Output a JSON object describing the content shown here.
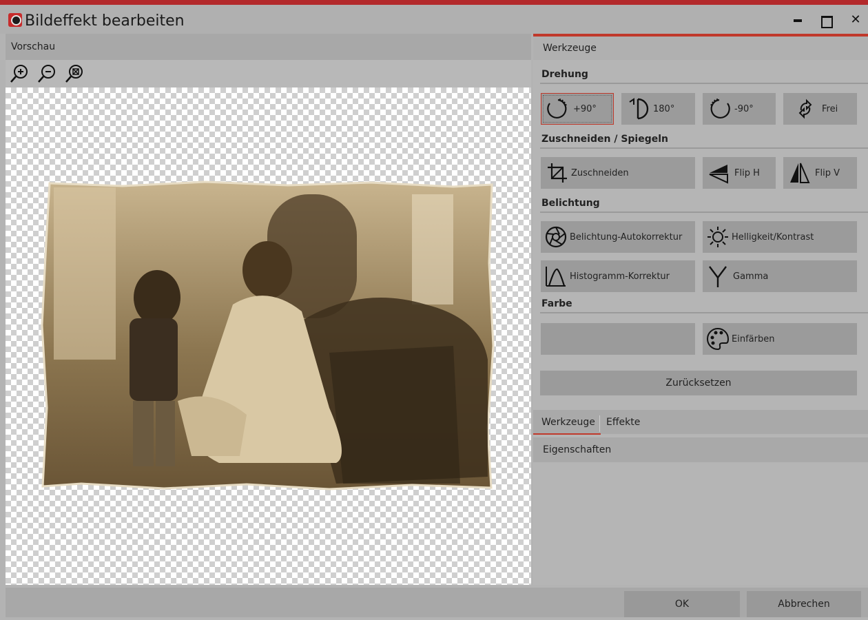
{
  "window": {
    "title": "Bildeffekt bearbeiten"
  },
  "preview": {
    "title": "Vorschau",
    "zoom_buttons": [
      "zoom-in-icon",
      "zoom-out-icon",
      "zoom-fit-icon"
    ]
  },
  "tools": {
    "title": "Werkzeuge",
    "sections": {
      "drehung": "Drehung",
      "zuschneiden": "Zuschneiden / Spiegeln",
      "belichtung": "Belichtung",
      "farbe": "Farbe"
    },
    "drehung": [
      {
        "label": "+90°",
        "icon": "rotate-cw-icon",
        "active": true
      },
      {
        "label": "180°",
        "icon": "rotate-180-icon",
        "active": false
      },
      {
        "label": "-90°",
        "icon": "rotate-ccw-icon",
        "active": false
      },
      {
        "label": "Frei",
        "icon": "free-rotate-icon",
        "active": false
      }
    ],
    "zuschneiden": [
      {
        "label": "Zuschneiden",
        "icon": "crop-icon"
      },
      {
        "label": "Flip H",
        "icon": "flip-horizontal-icon"
      },
      {
        "label": "Flip V",
        "icon": "flip-vertical-icon"
      }
    ],
    "belichtung": [
      {
        "label": "Belichtung-Autokorrektur",
        "icon": "aperture-icon"
      },
      {
        "label": "Helligkeit/Kontrast",
        "icon": "sun-icon"
      },
      {
        "label": "Histogramm-Korrektur",
        "icon": "histogram-icon"
      },
      {
        "label": "Gamma",
        "icon": "gamma-icon"
      }
    ],
    "farbe": [
      {
        "label": "",
        "icon": ""
      },
      {
        "label": "Einfärben",
        "icon": "palette-icon"
      }
    ],
    "reset_label": "Zurücksetzen"
  },
  "tabs": [
    {
      "label": "Werkzeuge",
      "active": true
    },
    {
      "label": "Effekte",
      "active": false
    }
  ],
  "properties": {
    "title": "Eigenschaften"
  },
  "footer": {
    "ok_label": "OK",
    "cancel_label": "Abbrechen"
  },
  "colors": {
    "accent": "#c0392b",
    "button": "#9b9b9b",
    "panel": "#b5b5b5",
    "sepia": "#b49a6c"
  }
}
